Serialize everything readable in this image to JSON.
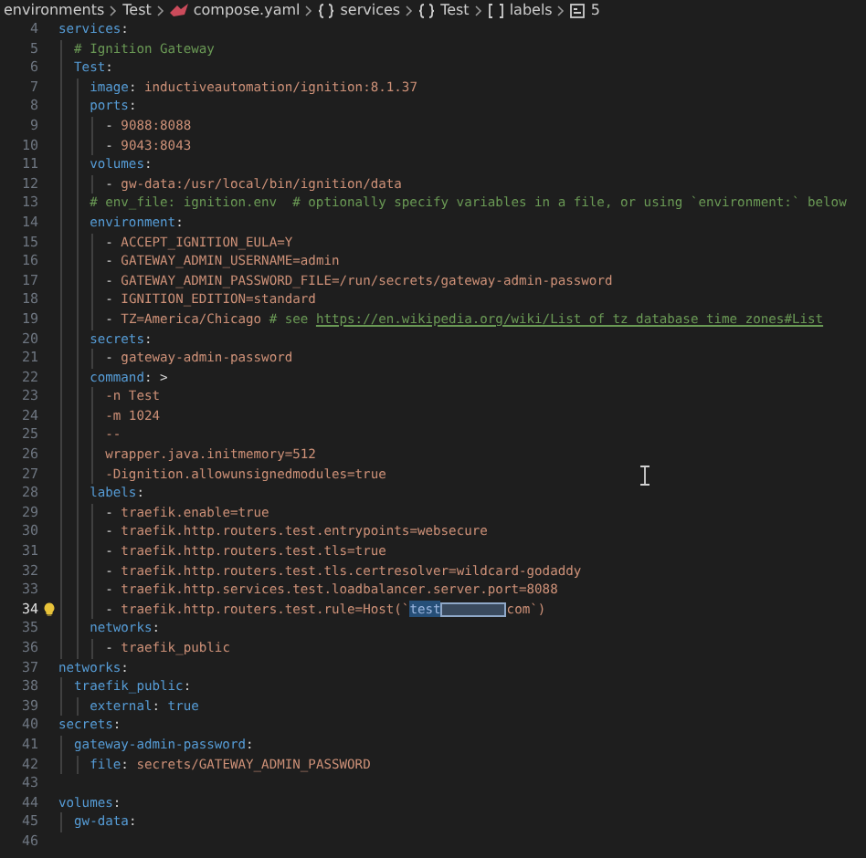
{
  "breadcrumbs": [
    {
      "label": "environments",
      "kind": "folder"
    },
    {
      "label": "Test",
      "kind": "folder"
    },
    {
      "label": "compose.yaml",
      "kind": "yaml"
    },
    {
      "label": "services",
      "kind": "object"
    },
    {
      "label": "Test",
      "kind": "object"
    },
    {
      "label": "labels",
      "kind": "array"
    },
    {
      "label": "5",
      "kind": "field"
    }
  ],
  "editor": {
    "lines": [
      {
        "number": "4",
        "tokens": [
          {
            "text": "services",
            "kind": "key"
          },
          {
            "text": ":",
            "kind": "punct"
          }
        ]
      },
      {
        "number": "5",
        "tokens": [
          {
            "text": "  # Ignition Gateway",
            "kind": "comment"
          }
        ]
      },
      {
        "number": "6",
        "tokens": [
          {
            "text": "  Test",
            "kind": "key"
          },
          {
            "text": ":",
            "kind": "punct"
          }
        ]
      },
      {
        "number": "7",
        "tokens": [
          {
            "text": "    image",
            "kind": "key"
          },
          {
            "text": ": ",
            "kind": "punct"
          },
          {
            "text": "inductiveautomation/ignition:8.1.37",
            "kind": "str"
          }
        ]
      },
      {
        "number": "8",
        "tokens": [
          {
            "text": "    ports",
            "kind": "key"
          },
          {
            "text": ":",
            "kind": "punct"
          }
        ]
      },
      {
        "number": "9",
        "tokens": [
          {
            "text": "      - ",
            "kind": "punct"
          },
          {
            "text": "9088:8088",
            "kind": "str"
          }
        ]
      },
      {
        "number": "10",
        "tokens": [
          {
            "text": "      - ",
            "kind": "punct"
          },
          {
            "text": "9043:8043",
            "kind": "str"
          }
        ]
      },
      {
        "number": "11",
        "tokens": [
          {
            "text": "    volumes",
            "kind": "key"
          },
          {
            "text": ":",
            "kind": "punct"
          }
        ]
      },
      {
        "number": "12",
        "tokens": [
          {
            "text": "      - ",
            "kind": "punct"
          },
          {
            "text": "gw-data:/usr/local/bin/ignition/data",
            "kind": "str"
          }
        ]
      },
      {
        "number": "13",
        "tokens": [
          {
            "text": "    # env_file: ignition.env  # optionally specify variables in a file, or using `environment:` below",
            "kind": "comment"
          }
        ]
      },
      {
        "number": "14",
        "tokens": [
          {
            "text": "    environment",
            "kind": "key"
          },
          {
            "text": ":",
            "kind": "punct"
          }
        ]
      },
      {
        "number": "15",
        "tokens": [
          {
            "text": "      - ",
            "kind": "punct"
          },
          {
            "text": "ACCEPT_IGNITION_EULA=Y",
            "kind": "str"
          }
        ]
      },
      {
        "number": "16",
        "tokens": [
          {
            "text": "      - ",
            "kind": "punct"
          },
          {
            "text": "GATEWAY_ADMIN_USERNAME=admin",
            "kind": "str"
          }
        ]
      },
      {
        "number": "17",
        "tokens": [
          {
            "text": "      - ",
            "kind": "punct"
          },
          {
            "text": "GATEWAY_ADMIN_PASSWORD_FILE=/run/secrets/gateway-admin-password",
            "kind": "str"
          }
        ]
      },
      {
        "number": "18",
        "tokens": [
          {
            "text": "      - ",
            "kind": "punct"
          },
          {
            "text": "IGNITION_EDITION=standard",
            "kind": "str"
          }
        ]
      },
      {
        "number": "19",
        "tokens": [
          {
            "text": "      - ",
            "kind": "punct"
          },
          {
            "text": "TZ=America/Chicago ",
            "kind": "str"
          },
          {
            "text": "# see ",
            "kind": "comment"
          },
          {
            "text": "https://en.wikipedia.org/wiki/List_of_tz_database_time_zones#List",
            "kind": "link"
          }
        ]
      },
      {
        "number": "20",
        "tokens": [
          {
            "text": "    secrets",
            "kind": "key"
          },
          {
            "text": ":",
            "kind": "punct"
          }
        ]
      },
      {
        "number": "21",
        "tokens": [
          {
            "text": "      - ",
            "kind": "punct"
          },
          {
            "text": "gateway-admin-password",
            "kind": "str"
          }
        ]
      },
      {
        "number": "22",
        "tokens": [
          {
            "text": "    command",
            "kind": "key"
          },
          {
            "text": ": >",
            "kind": "punct"
          }
        ]
      },
      {
        "number": "23",
        "tokens": [
          {
            "text": "      -n Test",
            "kind": "str"
          }
        ]
      },
      {
        "number": "24",
        "tokens": [
          {
            "text": "      -m 1024",
            "kind": "str"
          }
        ]
      },
      {
        "number": "25",
        "tokens": [
          {
            "text": "      --",
            "kind": "str"
          }
        ]
      },
      {
        "number": "26",
        "tokens": [
          {
            "text": "      wrapper.java.initmemory=512",
            "kind": "str"
          }
        ]
      },
      {
        "number": "27",
        "tokens": [
          {
            "text": "      -Dignition.allowunsignedmodules=true",
            "kind": "str"
          }
        ]
      },
      {
        "number": "28",
        "tokens": [
          {
            "text": "    labels",
            "kind": "key"
          },
          {
            "text": ":",
            "kind": "punct"
          }
        ]
      },
      {
        "number": "29",
        "tokens": [
          {
            "text": "      - ",
            "kind": "punct"
          },
          {
            "text": "traefik.enable=true",
            "kind": "str"
          }
        ]
      },
      {
        "number": "30",
        "tokens": [
          {
            "text": "      - ",
            "kind": "punct"
          },
          {
            "text": "traefik.http.routers.test.entrypoints=websecure",
            "kind": "str"
          }
        ]
      },
      {
        "number": "31",
        "tokens": [
          {
            "text": "      - ",
            "kind": "punct"
          },
          {
            "text": "traefik.http.routers.test.tls=true",
            "kind": "str"
          }
        ]
      },
      {
        "number": "32",
        "tokens": [
          {
            "text": "      - ",
            "kind": "punct"
          },
          {
            "text": "traefik.http.routers.test.tls.certresolver=wildcard-godaddy",
            "kind": "str"
          }
        ]
      },
      {
        "number": "33",
        "tokens": [
          {
            "text": "      - ",
            "kind": "punct"
          },
          {
            "text": "traefik.http.services.test.loadbalancer.server.port=8088",
            "kind": "str"
          }
        ]
      },
      {
        "number": "34",
        "lightbulb": true,
        "tokens": [
          {
            "text": "      - ",
            "kind": "punct"
          },
          {
            "text": "traefik.http.routers.test.rule=Host(`",
            "kind": "str"
          },
          {
            "text": "test",
            "kind": "selected"
          },
          {
            "kind": "redacted"
          },
          {
            "text": "com`)",
            "kind": "str"
          }
        ]
      },
      {
        "number": "35",
        "tokens": [
          {
            "text": "    networks",
            "kind": "key"
          },
          {
            "text": ":",
            "kind": "punct"
          }
        ]
      },
      {
        "number": "36",
        "tokens": [
          {
            "text": "      - ",
            "kind": "punct"
          },
          {
            "text": "traefik_public",
            "kind": "str"
          }
        ]
      },
      {
        "number": "37",
        "tokens": [
          {
            "text": "networks",
            "kind": "key"
          },
          {
            "text": ":",
            "kind": "punct"
          }
        ]
      },
      {
        "number": "38",
        "tokens": [
          {
            "text": "  traefik_public",
            "kind": "key"
          },
          {
            "text": ":",
            "kind": "punct"
          }
        ]
      },
      {
        "number": "39",
        "tokens": [
          {
            "text": "    external",
            "kind": "key"
          },
          {
            "text": ": ",
            "kind": "punct"
          },
          {
            "text": "true",
            "kind": "keyword"
          }
        ]
      },
      {
        "number": "40",
        "tokens": [
          {
            "text": "secrets",
            "kind": "key"
          },
          {
            "text": ":",
            "kind": "punct"
          }
        ]
      },
      {
        "number": "41",
        "tokens": [
          {
            "text": "  gateway-admin-password",
            "kind": "key"
          },
          {
            "text": ":",
            "kind": "punct"
          }
        ]
      },
      {
        "number": "42",
        "tokens": [
          {
            "text": "    file",
            "kind": "key"
          },
          {
            "text": ": ",
            "kind": "punct"
          },
          {
            "text": "secrets/GATEWAY_ADMIN_PASSWORD",
            "kind": "str"
          }
        ]
      },
      {
        "number": "43"
      },
      {
        "number": "44",
        "tokens": [
          {
            "text": "volumes",
            "kind": "key"
          },
          {
            "text": ":",
            "kind": "punct"
          }
        ]
      },
      {
        "number": "45",
        "tokens": [
          {
            "text": "  gw-data",
            "kind": "key"
          },
          {
            "text": ":",
            "kind": "punct"
          }
        ]
      },
      {
        "number": "46"
      }
    ]
  }
}
